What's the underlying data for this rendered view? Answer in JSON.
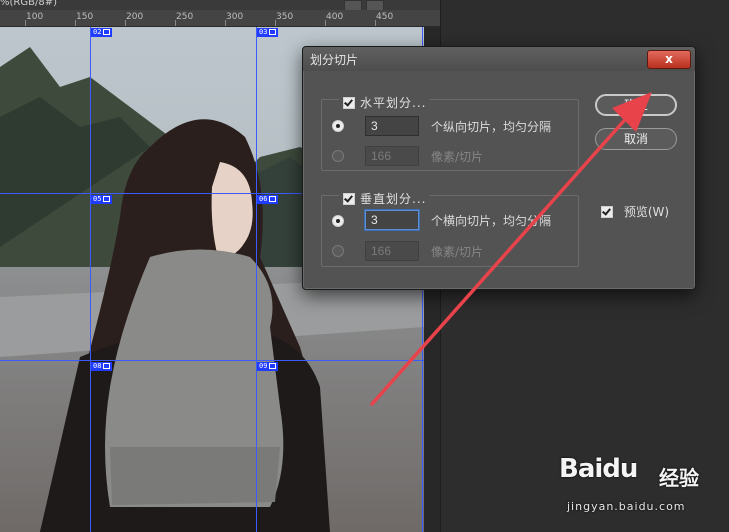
{
  "document": {
    "title_fragment": "%(RGB/8#)"
  },
  "ruler": {
    "labels": [
      "100",
      "150",
      "200",
      "250",
      "300",
      "350",
      "400",
      "450"
    ]
  },
  "slices": {
    "tags": [
      "02",
      "03",
      "05",
      "06",
      "08",
      "09"
    ],
    "color": "#3b5bff"
  },
  "dialog": {
    "title": "划分切片",
    "close_glyph": "x",
    "horizontal": {
      "checkbox_label": "水平划分...",
      "option1_value": "3",
      "option1_label": "个纵向切片，均匀分隔",
      "option2_value": "166",
      "option2_label": "像素/切片"
    },
    "vertical": {
      "checkbox_label": "垂直划分...",
      "option1_value": "3",
      "option1_label": "个横向切片，均匀分隔",
      "option2_value": "166",
      "option2_label": "像素/切片"
    },
    "ok_label": "确定",
    "cancel_label": "取消",
    "preview_label": "预览(W)"
  },
  "annotation": {
    "arrow_color": "#e8434a"
  },
  "watermark": {
    "logo": "Baidu",
    "logo_cn": "经验",
    "url": "jingyan.baidu.com"
  }
}
